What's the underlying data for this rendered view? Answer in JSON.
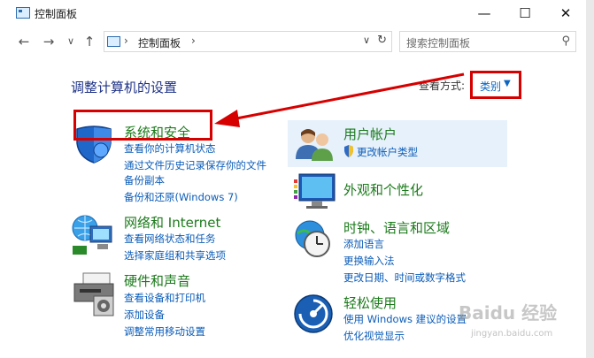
{
  "window": {
    "title": "控制面板",
    "minimize": "—",
    "maximize": "☐",
    "close": "✕"
  },
  "nav": {
    "back": "←",
    "forward": "→",
    "recent": "∨",
    "up": "↑",
    "address_sep": "›",
    "address_text": "控制面板",
    "address_sep2": "›",
    "address_dropdown": "∨",
    "refresh": "↻",
    "search_placeholder": "搜索控制面板",
    "search_glyph": "⚲"
  },
  "main": {
    "heading": "调整计算机的设置",
    "view_by_label": "查看方式:",
    "view_by_value": "类别",
    "view_by_caret": "▼"
  },
  "categories_left": [
    {
      "title": "系统和安全",
      "links": [
        "查看你的计算机状态",
        "通过文件历史记录保存你的文件",
        "备份副本",
        "备份和还原(Windows 7)"
      ]
    },
    {
      "title": "网络和 Internet",
      "links": [
        "查看网络状态和任务",
        "选择家庭组和共享选项"
      ]
    },
    {
      "title": "硬件和声音",
      "links": [
        "查看设备和打印机",
        "添加设备",
        "调整常用移动设置"
      ]
    }
  ],
  "categories_right": [
    {
      "title": "用户帐户",
      "links": [
        "更改帐户类型"
      ]
    },
    {
      "title": "外观和个性化",
      "links": []
    },
    {
      "title": "时钟、语言和区域",
      "links": [
        "添加语言",
        "更换输入法",
        "更改日期、时间或数字格式"
      ]
    },
    {
      "title": "轻松使用",
      "links": [
        "使用 Windows 建议的设置",
        "优化视觉显示"
      ]
    }
  ],
  "watermark": {
    "text": "Baidu 经验",
    "sub": "jingyan.baidu.com"
  },
  "colors": {
    "accent_red": "#d60000",
    "link_blue": "#0b5cb8",
    "category_green": "#1b7a1b"
  }
}
